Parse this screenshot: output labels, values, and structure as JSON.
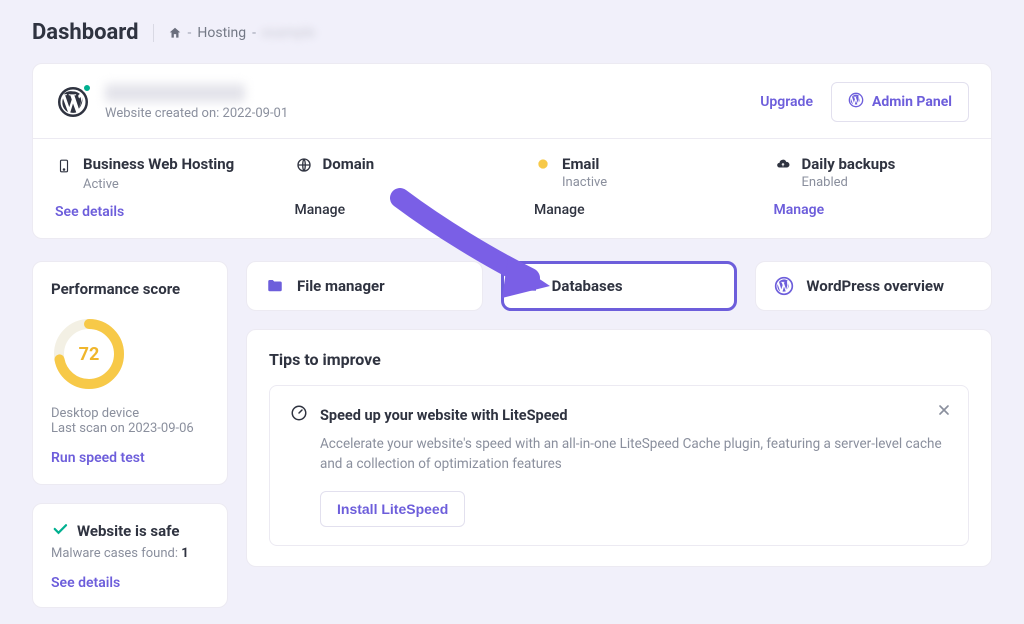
{
  "page": {
    "title": "Dashboard"
  },
  "breadcrumb": {
    "dash1": "-",
    "seg1": "Hosting",
    "dash2": "-",
    "seg2_blurred": "example"
  },
  "site": {
    "created_prefix": "Website created on:",
    "created_date": "2022-09-01",
    "upgrade": "Upgrade",
    "admin_panel": "Admin Panel"
  },
  "cells": {
    "hosting": {
      "title": "Business Web Hosting",
      "sub": "Active",
      "action": "See details"
    },
    "domain": {
      "title": "Domain",
      "action": "Manage"
    },
    "email": {
      "title": "Email",
      "sub": "Inactive",
      "action": "Manage"
    },
    "backups": {
      "title": "Daily backups",
      "sub": "Enabled",
      "action": "Manage"
    }
  },
  "perf": {
    "title": "Performance score",
    "score": "72",
    "device": "Desktop device",
    "last_scan": "Last scan on 2023-09-06",
    "run": "Run speed test"
  },
  "safe": {
    "title": "Website is safe",
    "sub_prefix": "Malware cases found:",
    "sub_count": "1",
    "link": "See details"
  },
  "tools": {
    "files": "File manager",
    "db": "Databases",
    "wp": "WordPress overview"
  },
  "tips": {
    "title": "Tips to improve",
    "head": "Speed up your website with LiteSpeed",
    "desc": "Accelerate your website's speed with an all-in-one LiteSpeed Cache plugin, featuring a server-level cache and a collection of optimization features",
    "btn": "Install LiteSpeed"
  }
}
